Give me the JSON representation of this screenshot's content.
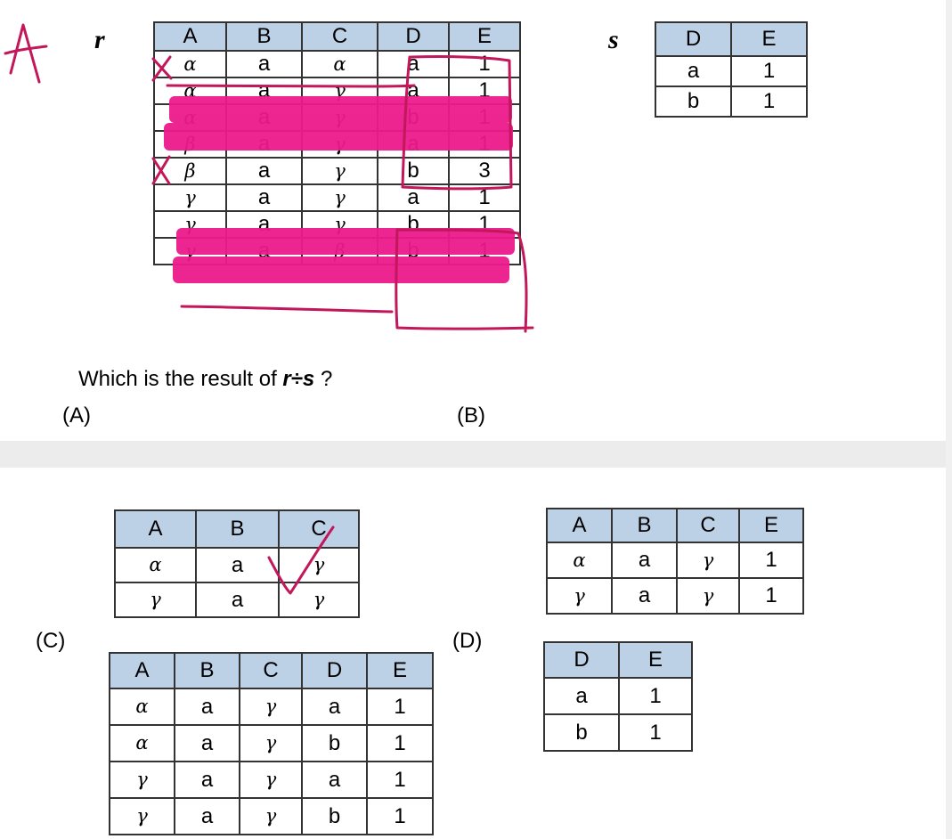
{
  "handwritten_answer": "A",
  "relation_r": {
    "label": "r",
    "headers": [
      "A",
      "B",
      "C",
      "D",
      "E"
    ],
    "rows": [
      [
        "α",
        "a",
        "α",
        "a",
        "1"
      ],
      [
        "α",
        "a",
        "γ",
        "a",
        "1"
      ],
      [
        "α",
        "a",
        "γ",
        "b",
        "1"
      ],
      [
        "β",
        "a",
        "γ",
        "a",
        "1"
      ],
      [
        "β",
        "a",
        "γ",
        "b",
        "3"
      ],
      [
        "γ",
        "a",
        "γ",
        "a",
        "1"
      ],
      [
        "γ",
        "a",
        "γ",
        "b",
        "1"
      ],
      [
        "γ",
        "a",
        "β",
        "b",
        "1"
      ]
    ]
  },
  "relation_s": {
    "label": "s",
    "headers": [
      "D",
      "E"
    ],
    "rows": [
      [
        "a",
        "1"
      ],
      [
        "b",
        "1"
      ]
    ]
  },
  "question": {
    "prefix": "Which is the result of",
    "expression": "r÷s",
    "suffix": "?"
  },
  "options": {
    "A_label": "(A)",
    "B_label": "(B)",
    "C_label": "(C)",
    "D_label": "(D)",
    "table_A": {
      "headers": [
        "A",
        "B",
        "C"
      ],
      "rows": [
        [
          "α",
          "a",
          "γ"
        ],
        [
          "γ",
          "a",
          "γ"
        ]
      ]
    },
    "table_B": {
      "headers": [
        "A",
        "B",
        "C",
        "E"
      ],
      "rows": [
        [
          "α",
          "a",
          "γ",
          "1"
        ],
        [
          "γ",
          "a",
          "γ",
          "1"
        ]
      ]
    },
    "table_C": {
      "headers": [
        "A",
        "B",
        "C",
        "D",
        "E"
      ],
      "rows": [
        [
          "α",
          "a",
          "γ",
          "a",
          "1"
        ],
        [
          "α",
          "a",
          "γ",
          "b",
          "1"
        ],
        [
          "γ",
          "a",
          "γ",
          "a",
          "1"
        ],
        [
          "γ",
          "a",
          "γ",
          "b",
          "1"
        ]
      ]
    },
    "table_D": {
      "headers": [
        "D",
        "E"
      ],
      "rows": [
        [
          "a",
          "1"
        ],
        [
          "b",
          "1"
        ]
      ]
    }
  },
  "colors": {
    "header_fill": "#bcd0e6",
    "highlight": "#ec1a8c",
    "ink": "#c2185b"
  }
}
